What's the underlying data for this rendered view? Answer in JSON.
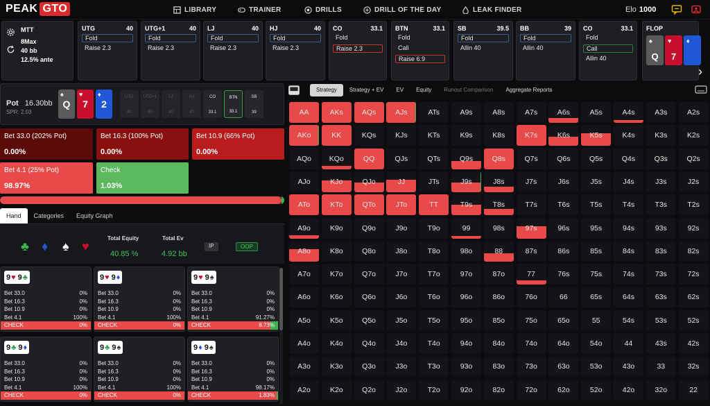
{
  "brand": {
    "name": "PEAK",
    "badge": "GTO"
  },
  "nav": [
    {
      "label": "LIBRARY",
      "icon": "grid-icon"
    },
    {
      "label": "TRAINER",
      "icon": "gamepad-icon"
    },
    {
      "label": "DRILLS",
      "icon": "target-icon"
    },
    {
      "label": "DRILL OF THE DAY",
      "icon": "plus-circle-icon"
    },
    {
      "label": "LEAK FINDER",
      "icon": "droplet-icon"
    }
  ],
  "elo": {
    "label": "Elo",
    "value": "1000"
  },
  "colors": {
    "red": "#e84a4a",
    "green": "#3cb44b",
    "dark_red": "#5c0a0a",
    "card_blue": "#1f57d6",
    "card_red": "#c8102e"
  },
  "game": {
    "format": "MTT",
    "table": "8Max",
    "stack": "40 bb",
    "ante": "12.5% ante"
  },
  "positions": [
    {
      "name": "UTG",
      "stack": "40",
      "actions": [
        {
          "label": "Fold",
          "state": "selected"
        },
        {
          "label": "Raise 2.3",
          "state": ""
        }
      ]
    },
    {
      "name": "UTG+1",
      "stack": "40",
      "actions": [
        {
          "label": "Fold",
          "state": "selected"
        },
        {
          "label": "Raise 2.3",
          "state": ""
        }
      ]
    },
    {
      "name": "LJ",
      "stack": "40",
      "actions": [
        {
          "label": "Fold",
          "state": "selected"
        },
        {
          "label": "Raise 2.3",
          "state": ""
        }
      ]
    },
    {
      "name": "HJ",
      "stack": "40",
      "actions": [
        {
          "label": "Fold",
          "state": "selected"
        },
        {
          "label": "Raise 2.3",
          "state": ""
        }
      ]
    },
    {
      "name": "CO",
      "stack": "33.1",
      "actions": [
        {
          "label": "Fold",
          "state": ""
        },
        {
          "label": "Raise 2.3",
          "state": "red"
        }
      ]
    },
    {
      "name": "BTN",
      "stack": "33.1",
      "actions": [
        {
          "label": "Fold",
          "state": ""
        },
        {
          "label": "Call",
          "state": ""
        },
        {
          "label": "Raise 6.9",
          "state": "red"
        }
      ]
    },
    {
      "name": "SB",
      "stack": "39.5",
      "actions": [
        {
          "label": "Fold",
          "state": "selected"
        },
        {
          "label": "Allin 40",
          "state": ""
        }
      ]
    },
    {
      "name": "BB",
      "stack": "39",
      "actions": [
        {
          "label": "Fold",
          "state": "selected"
        },
        {
          "label": "Allin 40",
          "state": ""
        }
      ]
    },
    {
      "name": "CO",
      "stack": "33.1",
      "actions": [
        {
          "label": "Fold",
          "state": ""
        },
        {
          "label": "Call",
          "state": "green"
        },
        {
          "label": "Allin 40",
          "state": ""
        }
      ]
    }
  ],
  "flop": {
    "label": "FLOP",
    "cards": [
      {
        "rank": "Q",
        "suit": "♠",
        "color": "#5a5a5a"
      },
      {
        "rank": "7",
        "suit": "♥",
        "color": "#c8102e"
      },
      {
        "rank": "",
        "suit": "♦",
        "color": "#1f57d6"
      }
    ]
  },
  "board": {
    "pot_label": "Pot",
    "pot_value": "16.30bb",
    "spr": "SPR: 2.03",
    "cards": [
      {
        "rank": "Q",
        "suit": "♠",
        "color": "#5a5a5a"
      },
      {
        "rank": "7",
        "suit": "♥",
        "color": "#c8102e"
      },
      {
        "rank": "2",
        "suit": "♦",
        "color": "#1f57d6"
      }
    ],
    "seats": [
      {
        "name": "UTG",
        "stack": "40"
      },
      {
        "name": "UTG+1",
        "stack": "40"
      },
      {
        "name": "LJ",
        "stack": "40"
      },
      {
        "name": "HJ",
        "stack": "40"
      },
      {
        "name": "CO",
        "stack": "33.1"
      },
      {
        "name": "BTN",
        "stack": "33.1"
      },
      {
        "name": "SB",
        "stack": "39"
      }
    ]
  },
  "bets": [
    {
      "label": "Bet 33.0 (202% Pot)",
      "value": "0.00%"
    },
    {
      "label": "Bet 16.3 (100% Pot)",
      "value": "0.00%"
    },
    {
      "label": "Bet 10.9 (66% Pot)",
      "value": "0.00%"
    },
    {
      "label": "Bet 4.1 (25% Pot)",
      "value": "98.97%"
    },
    {
      "label": "Check",
      "value": "1.03%"
    }
  ],
  "progress": {
    "fraction": 0.9897
  },
  "hand_tabs": [
    "Hand",
    "Categories",
    "Equity Graph"
  ],
  "equity": {
    "total_equity_label": "Total Equity",
    "total_equity": "40.85 %",
    "total_ev_label": "Total Ev",
    "total_ev": "4.92 bb",
    "ip": "IP",
    "oop": "OOP"
  },
  "suits": [
    {
      "glyph": "♣",
      "color": "#3cb44b"
    },
    {
      "glyph": "♦",
      "color": "#1f57d6"
    },
    {
      "glyph": "♠",
      "color": "#ffffff"
    },
    {
      "glyph": "♥",
      "color": "#c8102e"
    }
  ],
  "combos": [
    {
      "c1": "9",
      "s1": "♥",
      "col1": "#c8102e",
      "c2": "9",
      "s2": "♣",
      "col2": "#2f9e44",
      "rows": [
        [
          "Bet 33.0",
          "0%"
        ],
        [
          "Bet 16.3",
          "0%"
        ],
        [
          "Bet 10.9",
          "0%"
        ],
        [
          "Bet 4.1",
          "100%"
        ],
        [
          "CHECK",
          "0%"
        ]
      ],
      "green": 0
    },
    {
      "c1": "9",
      "s1": "♥",
      "col1": "#c8102e",
      "c2": "9",
      "s2": "♦",
      "col2": "#1f57d6",
      "rows": [
        [
          "Bet 33.0",
          "0%"
        ],
        [
          "Bet 16.3",
          "0%"
        ],
        [
          "Bet 10.9",
          "0%"
        ],
        [
          "Bet 4.1",
          "100%"
        ],
        [
          "CHECK",
          "0%"
        ]
      ],
      "green": 0
    },
    {
      "c1": "9",
      "s1": "♥",
      "col1": "#c8102e",
      "c2": "9",
      "s2": "♠",
      "col2": "#333333",
      "rows": [
        [
          "Bet 33.0",
          "0%"
        ],
        [
          "Bet 16.3",
          "0%"
        ],
        [
          "Bet 10.9",
          "0%"
        ],
        [
          "Bet 4.1",
          "91.27%"
        ],
        [
          "CHECK",
          "8.73%"
        ]
      ],
      "green": 0.0873
    },
    {
      "c1": "9",
      "s1": "♣",
      "col1": "#2f9e44",
      "c2": "9",
      "s2": "♦",
      "col2": "#1f57d6",
      "rows": [
        [
          "Bet 33.0",
          "0%"
        ],
        [
          "Bet 16.3",
          "0%"
        ],
        [
          "Bet 10.9",
          "0%"
        ],
        [
          "Bet 4.1",
          "100%"
        ],
        [
          "CHECK",
          "0%"
        ]
      ],
      "green": 0
    },
    {
      "c1": "9",
      "s1": "♣",
      "col1": "#2f9e44",
      "c2": "9",
      "s2": "♠",
      "col2": "#333333",
      "rows": [
        [
          "Bet 33.0",
          "0%"
        ],
        [
          "Bet 16.3",
          "0%"
        ],
        [
          "Bet 10.9",
          "0%"
        ],
        [
          "Bet 4.1",
          "100%"
        ],
        [
          "CHECK",
          "0%"
        ]
      ],
      "green": 0
    },
    {
      "c1": "9",
      "s1": "♦",
      "col1": "#1f57d6",
      "c2": "9",
      "s2": "♠",
      "col2": "#333333",
      "rows": [
        [
          "Bet 33.0",
          "0%"
        ],
        [
          "Bet 16.3",
          "0%"
        ],
        [
          "Bet 10.9",
          "0%"
        ],
        [
          "Bet 4.1",
          "98.17%"
        ],
        [
          "CHECK",
          "1.83%"
        ]
      ],
      "green": 0.0183
    }
  ],
  "right_tabs": [
    {
      "label": "Strategy",
      "on": true
    },
    {
      "label": "Strategy + EV"
    },
    {
      "label": "EV"
    },
    {
      "label": "Equity"
    },
    {
      "label": "Runout Comparison",
      "dim": true
    },
    {
      "label": "Aggregate Reports"
    }
  ],
  "ranks": [
    "A",
    "K",
    "Q",
    "J",
    "T",
    "9",
    "8",
    "7",
    "6",
    "5",
    "4",
    "3",
    "2"
  ],
  "grid_fill": {
    "AA": [
      1,
      0
    ],
    "AKs": [
      1,
      0
    ],
    "AQs": [
      1,
      0
    ],
    "AJs": [
      1,
      0.04
    ],
    "A6s": [
      0.25,
      0
    ],
    "A4s": [
      0.12,
      0
    ],
    "AKo": [
      1,
      0.03
    ],
    "KK": [
      1,
      0
    ],
    "K7s": [
      1,
      0
    ],
    "K6s": [
      0.45,
      0
    ],
    "K5s": [
      0.6,
      0
    ],
    "KQo": [
      0.15,
      0
    ],
    "QQ": [
      1,
      0
    ],
    "Q9s": [
      0.4,
      0
    ],
    "Q8s": [
      1,
      0
    ],
    "KJo": [
      0.55,
      0
    ],
    "QJo": [
      0.45,
      0
    ],
    "JJ": [
      0.6,
      0
    ],
    "J9s": [
      0.45,
      0.03
    ],
    "J8s": [
      0.25,
      0
    ],
    "ATo": [
      1,
      0
    ],
    "KTo": [
      1,
      0
    ],
    "QTo": [
      1,
      0
    ],
    "JTo": [
      1,
      0
    ],
    "TT": [
      1,
      0
    ],
    "T9s": [
      0.5,
      0
    ],
    "T8s": [
      0.3,
      0
    ],
    "A9o": [
      0.15,
      0
    ],
    "99": [
      0.12,
      0
    ],
    "97s": [
      0.6,
      0
    ],
    "A8o": [
      0.6,
      0
    ],
    "88": [
      0.4,
      0
    ],
    "77": [
      0.2,
      0
    ]
  }
}
